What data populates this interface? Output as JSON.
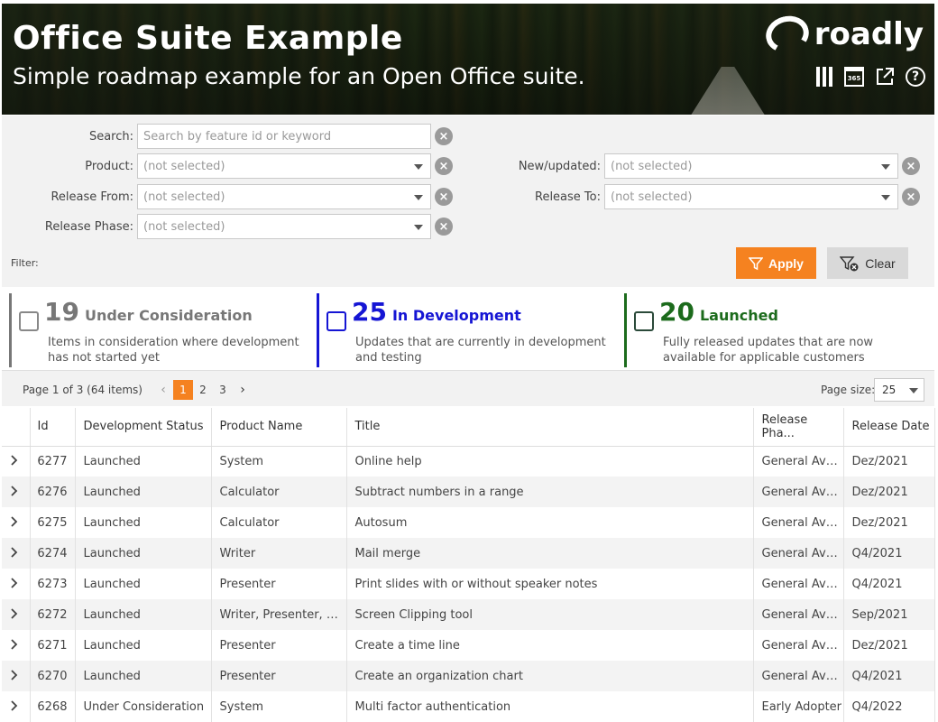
{
  "header": {
    "title": "Office Suite Example",
    "subtitle": "Simple roadmap example for an Open Office suite.",
    "brand": "roadly",
    "icons": [
      "columns-icon",
      "calendar-365-icon",
      "external-link-icon",
      "help-icon"
    ],
    "calendar_badge": "365"
  },
  "filters": {
    "search": {
      "label": "Search:",
      "placeholder": "Search by feature id or keyword"
    },
    "product": {
      "label": "Product:",
      "value": "(not selected)"
    },
    "release_from": {
      "label": "Release From:",
      "value": "(not selected)"
    },
    "release_phase": {
      "label": "Release Phase:",
      "value": "(not selected)"
    },
    "new_updated": {
      "label": "New/updated:",
      "value": "(not selected)"
    },
    "release_to": {
      "label": "Release To:",
      "value": "(not selected)"
    },
    "filter_label": "Filter:",
    "apply_label": "Apply",
    "clear_label": "Clear",
    "accent": "#f58220"
  },
  "status_cards": [
    {
      "count": "19",
      "label": "Under Consideration",
      "description": "Items in consideration where development has not started yet",
      "color": "#777777"
    },
    {
      "count": "25",
      "label": "In Development",
      "description": "Updates that are currently in development and testing",
      "color": "#1515d4"
    },
    {
      "count": "20",
      "label": "Launched",
      "description": "Fully released updates that are now available for applicable customers",
      "color": "#1c6b1c"
    }
  ],
  "pager": {
    "info": "Page 1 of 3 (64 items)",
    "pages": [
      "1",
      "2",
      "3"
    ],
    "current_page": "1",
    "page_size_label": "Page size:",
    "page_size": "25"
  },
  "grid": {
    "columns": [
      "Id",
      "Development Status",
      "Product Name",
      "Title",
      "Release Pha...",
      "Release Date"
    ],
    "rows": [
      [
        "6277",
        "Launched",
        "System",
        "Online help",
        "General Avai...",
        "Dez/2021"
      ],
      [
        "6276",
        "Launched",
        "Calculator",
        "Subtract numbers in a range",
        "General Avai...",
        "Dez/2021"
      ],
      [
        "6275",
        "Launched",
        "Calculator",
        "Autosum",
        "General Avai...",
        "Dez/2021"
      ],
      [
        "6274",
        "Launched",
        "Writer",
        "Mail merge",
        "General Avai...",
        "Q4/2021"
      ],
      [
        "6273",
        "Launched",
        "Presenter",
        "Print slides with or without speaker notes",
        "General Avai...",
        "Q4/2021"
      ],
      [
        "6272",
        "Launched",
        "Writer, Presenter, Cal...",
        "Screen Clipping tool",
        "General Avai...",
        "Sep/2021"
      ],
      [
        "6271",
        "Launched",
        "Presenter",
        "Create a time line",
        "General Avai...",
        "Dez/2021"
      ],
      [
        "6270",
        "Launched",
        "Presenter",
        "Create an organization chart",
        "General Avai...",
        "Q4/2021"
      ],
      [
        "6268",
        "Under Consideration",
        "System",
        "Multi factor authentication",
        "Early Adopter",
        "Q4/2022"
      ]
    ]
  }
}
